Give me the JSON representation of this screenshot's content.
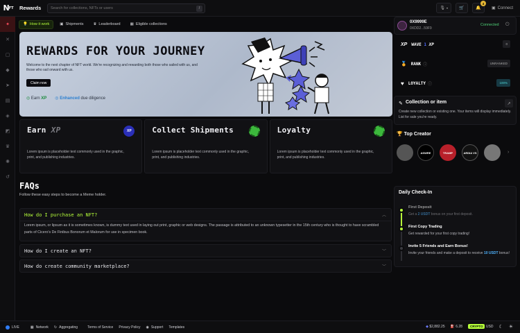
{
  "app": {
    "logo": "N",
    "logo_sub": "FT",
    "page_title": "Rewards"
  },
  "search": {
    "placeholder": "Search for collections, NFTs or users",
    "shortcut": "/"
  },
  "topbar": {
    "notifications_count": "4",
    "connect_label": "Connect"
  },
  "tabs": [
    {
      "label": "How it work",
      "active": true
    },
    {
      "label": "Shipments"
    },
    {
      "label": "Leaderboard"
    },
    {
      "label": "Eligible collections"
    }
  ],
  "hero": {
    "title": "REWARDS FOR YOUR JOURNEY",
    "description": "Welcome to the next chapter of NFT world. We're recognizing and rewarding both those who sailed with us, and those who sail onward with us.",
    "claim_label": "Claim now",
    "feat1_pre": "Earn",
    "feat1": "XP",
    "feat2": "Enhanced",
    "feat2_post": "due diligence"
  },
  "cards": [
    {
      "title": "Earn",
      "title_accent": "XP",
      "text": "Lorem ipsum is placeholder text commonly used in the graphic, print, and publishing industries.",
      "icon_label": "XP"
    },
    {
      "title": "Collect Shipments",
      "text": "Lorem ipsum is placeholder text commonly used in the graphic, print, and publishing industries."
    },
    {
      "title": "Loyalty",
      "text": "Lorem ipsum is placeholder text commonly used in the graphic, print, and publishing industries."
    }
  ],
  "faq": {
    "title": "FAQs",
    "subtitle": "Follow these easy steps to become a Meme holder.",
    "items": [
      {
        "q": "How do I purchase an NFT?",
        "a": "Lorem ipsum, or lipsum as it is sometimes known, is dummy text used in laying out print, graphic or web designs. The passage is attributed to an unknown typesetter in the 15th century who is thought to have scrambled parts of Cicero's De Finibus Bonorum et Malorum for use in specimen book."
      },
      {
        "q": "How do I create an NFT?"
      },
      {
        "q": "How do create community marketplace?"
      }
    ]
  },
  "profile": {
    "name": "0X9999E",
    "address": "0XDD2...59F9",
    "status": "Connected"
  },
  "stats": {
    "wave_label": "WAVE",
    "wave_num": "1",
    "wave_xp": "XP",
    "wave_value": "0",
    "rank_label": "RANK",
    "rank_value": "UNRANKED",
    "loyalty_label": "LOYALTY",
    "loyalty_value": "100%"
  },
  "collection": {
    "title": "Collection or item",
    "text": "Create new collection or existing one. Your items will display immediately. List for sale you're ready."
  },
  "creators": {
    "title": "Top Creator",
    "items": [
      "",
      "ASWRE",
      "TRAMP",
      "ARDIA VS",
      ""
    ]
  },
  "checkin": {
    "title": "Daily Check-In",
    "items": [
      {
        "title": "First Deposit",
        "pre": "Get a ",
        "bold": "2 USDT",
        "post": " bonus on your first deposit."
      },
      {
        "title": "First Copy Trading",
        "pre": "Get rewarded for your first copy trading!",
        "bold": "",
        "post": ""
      },
      {
        "title": "Invite 5 Friends and Earn Bonus!",
        "pre": "Invite your friends and make a deposit to receive ",
        "bold": "10 USDT",
        "post": " bonus!"
      }
    ]
  },
  "bottom": {
    "live": "LIVE",
    "network": "Network",
    "aggregating": "Aggregating",
    "links": [
      "Terms of Service",
      "Privacy Policy",
      "Support",
      "Templates"
    ],
    "eth_price": "$2,882.25",
    "gas": "6.28",
    "crypto": "CRYPTO",
    "currency": "USD"
  }
}
